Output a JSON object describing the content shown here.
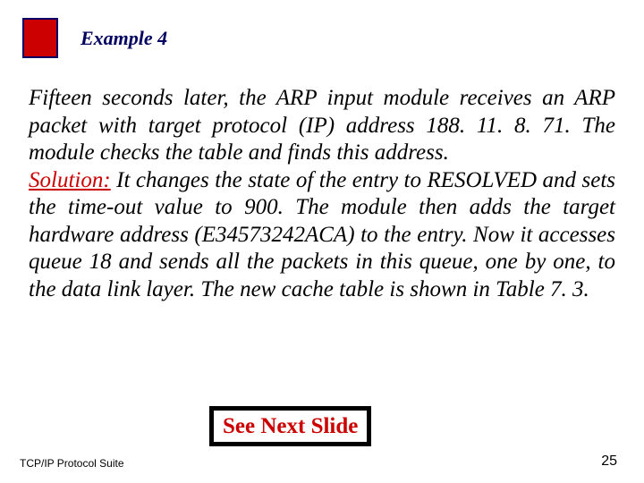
{
  "header": {
    "example_label": "Example 4"
  },
  "body": {
    "paragraph1": "Fifteen seconds later, the ARP input module receives an ARP packet with target protocol (IP) address 188. 11. 8. 71. The module checks the table and finds this address.",
    "solution_label": "Solution:",
    "paragraph2": " It changes the state of the entry to RESOLVED and sets the time-out value to 900. The module then adds the target hardware address (E34573242ACA) to the entry. Now it accesses queue 18 and sends all the packets in this queue, one by one, to the data link layer. The new cache table is shown in Table 7. 3."
  },
  "cta": {
    "see_next": "See Next Slide"
  },
  "footer": {
    "left": "TCP/IP Protocol Suite",
    "right": "25"
  }
}
